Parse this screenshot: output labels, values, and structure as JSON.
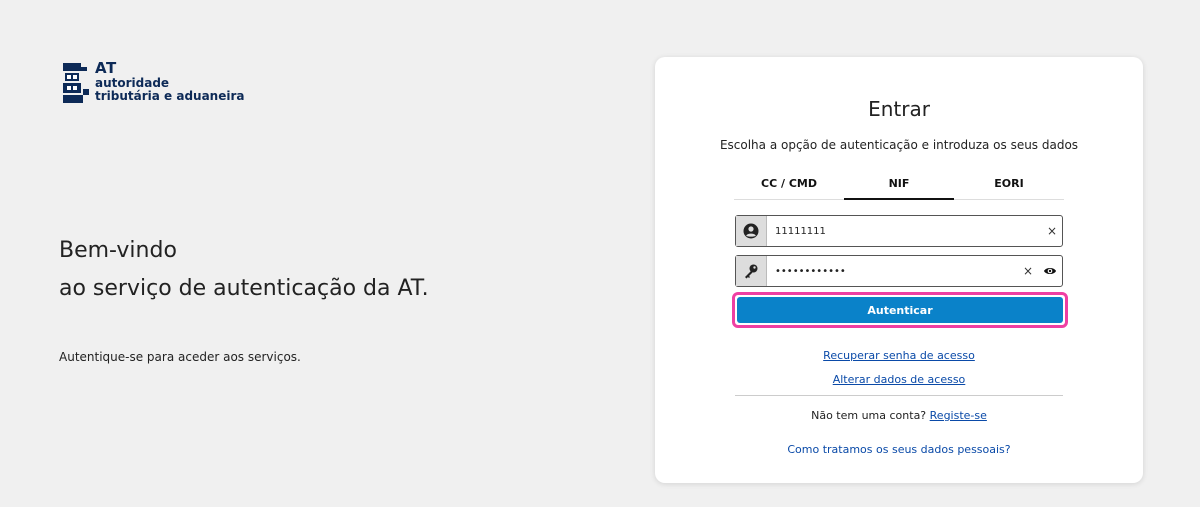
{
  "logo": {
    "abbr": "AT",
    "line1": "autoridade",
    "line2": "tributária e aduaneira",
    "color": "#0d2a57"
  },
  "welcome": {
    "title_line1": "Bem-vindo",
    "title_line2": "ao serviço de autenticação da AT.",
    "subtitle": "Autentique-se para aceder aos serviços."
  },
  "login": {
    "title": "Entrar",
    "instruction": "Escolha a opção de autenticação e introduza os seus dados",
    "tabs": [
      {
        "label": "CC / CMD",
        "active": false
      },
      {
        "label": "NIF",
        "active": true
      },
      {
        "label": "EORI",
        "active": false
      }
    ],
    "nif_value": "11111111",
    "password_value": "••••••••••••",
    "clear_symbol": "×",
    "submit_label": "Autenticar",
    "recover_link": "Recuperar senha de acesso",
    "change_link": "Alterar dados de acesso",
    "no_account_text": "Não tem uma conta?",
    "register_link": "Registe-se",
    "privacy_link": "Como tratamos os seus dados pessoais?",
    "icons": {
      "user": "user-circle-icon",
      "password": "key-icon",
      "show_password": "eye-icon"
    },
    "colors": {
      "button": "#0a82c9",
      "highlight": "#ef3fa3",
      "link": "#0a4aa8"
    }
  }
}
